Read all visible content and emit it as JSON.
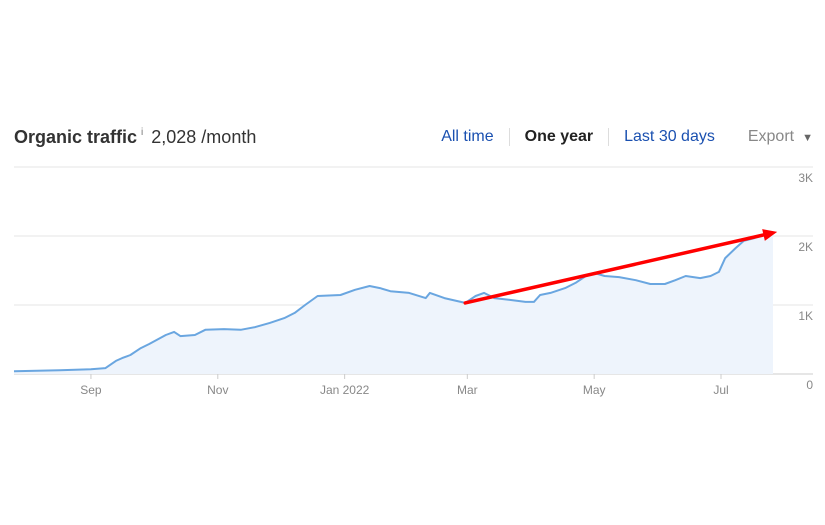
{
  "header": {
    "title": "Organic traffic",
    "info_icon": "i",
    "metric": "2,028 /month",
    "tabs": [
      {
        "label": "All time",
        "active": false
      },
      {
        "label": "One year",
        "active": true
      },
      {
        "label": "Last 30 days",
        "active": false
      }
    ],
    "export_label": "Export",
    "export_icon": "caret-down-icon"
  },
  "chart_data": {
    "type": "area",
    "title": "Organic traffic",
    "x_unit": "days since start of range (one year, ~late Jul 2021 to ~late Jul 2022)",
    "x_range": [
      0,
      365
    ],
    "ylim": [
      0,
      3000
    ],
    "y_ticks": [
      {
        "value": 0,
        "label": "0"
      },
      {
        "value": 1000,
        "label": "1K"
      },
      {
        "value": 2000,
        "label": "2K"
      },
      {
        "value": 3000,
        "label": "3K"
      }
    ],
    "x_ticks": [
      {
        "value": 37,
        "label": "Sep"
      },
      {
        "value": 98,
        "label": "Nov"
      },
      {
        "value": 159,
        "label": "Jan 2022"
      },
      {
        "value": 218,
        "label": "Mar"
      },
      {
        "value": 279,
        "label": "May"
      },
      {
        "value": 340,
        "label": "Jul"
      }
    ],
    "grid": true,
    "colors": {
      "line": "#6aa6e0",
      "fill": "#eef4fc",
      "arrow": "#ff0000"
    },
    "series": [
      {
        "name": "Organic traffic",
        "x": [
          0,
          22,
          37,
          44,
          49,
          52,
          56,
          61,
          65,
          73,
          77,
          80,
          87,
          92,
          101,
          109,
          116,
          123,
          130,
          135,
          140,
          146,
          157,
          164,
          171,
          176,
          181,
          190,
          198,
          200,
          207,
          217,
          222,
          226,
          231,
          238,
          246,
          250,
          253,
          258,
          265,
          270,
          275,
          279,
          284,
          291,
          299,
          306,
          313,
          318,
          323,
          330,
          335,
          339,
          342,
          347,
          351,
          356,
          361,
          365
        ],
        "values": [
          40,
          55,
          70,
          85,
          190,
          230,
          275,
          375,
          435,
          565,
          610,
          550,
          565,
          640,
          650,
          640,
          680,
          740,
          810,
          885,
          1000,
          1130,
          1145,
          1220,
          1275,
          1245,
          1200,
          1175,
          1100,
          1175,
          1100,
          1030,
          1130,
          1175,
          1100,
          1075,
          1045,
          1045,
          1145,
          1175,
          1245,
          1320,
          1420,
          1465,
          1420,
          1405,
          1360,
          1305,
          1305,
          1360,
          1420,
          1390,
          1420,
          1480,
          1680,
          1825,
          1930,
          1970,
          2015,
          2060
        ]
      }
    ],
    "annotations": [
      {
        "type": "arrow",
        "from": [
          217,
          1030
        ],
        "to": [
          367,
          2060
        ]
      }
    ]
  }
}
